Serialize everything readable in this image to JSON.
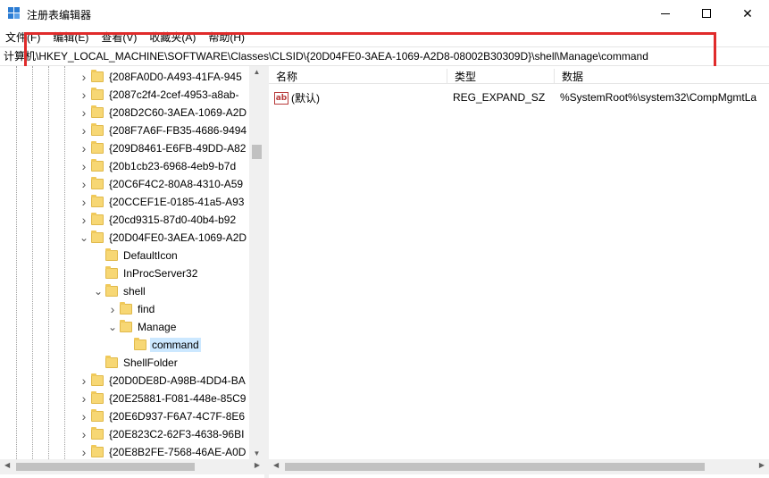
{
  "window": {
    "title": "注册表编辑器",
    "minimize_icon": "minimize-icon",
    "maximize_icon": "maximize-icon",
    "close_glyph": "✕"
  },
  "menu": [
    "文件(F)",
    "编辑(E)",
    "查看(V)",
    "收藏夹(A)",
    "帮助(H)"
  ],
  "address": "计算机\\HKEY_LOCAL_MACHINE\\SOFTWARE\\Classes\\CLSID\\{20D04FE0-3AEA-1069-A2D8-08002B30309D}\\shell\\Manage\\command",
  "tree": [
    {
      "label": "{208FA0D0-A493-41FA-945",
      "level": 0,
      "expander": ">"
    },
    {
      "label": "{2087c2f4-2cef-4953-a8ab-",
      "level": 0,
      "expander": ">"
    },
    {
      "label": "{208D2C60-3AEA-1069-A2D",
      "level": 0,
      "expander": ">"
    },
    {
      "label": "{208F7A6F-FB35-4686-9494",
      "level": 0,
      "expander": ">"
    },
    {
      "label": "{209D8461-E6FB-49DD-A82",
      "level": 0,
      "expander": ">"
    },
    {
      "label": "{20b1cb23-6968-4eb9-b7d",
      "level": 0,
      "expander": ">"
    },
    {
      "label": "{20C6F4C2-80A8-4310-A59",
      "level": 0,
      "expander": ">"
    },
    {
      "label": "{20CCEF1E-0185-41a5-A93",
      "level": 0,
      "expander": ">"
    },
    {
      "label": "{20cd9315-87d0-40b4-b92",
      "level": 0,
      "expander": ">"
    },
    {
      "label": "{20D04FE0-3AEA-1069-A2D",
      "level": 0,
      "expander": "v"
    },
    {
      "label": "DefaultIcon",
      "level": 1,
      "expander": ""
    },
    {
      "label": "InProcServer32",
      "level": 1,
      "expander": ""
    },
    {
      "label": "shell",
      "level": 1,
      "expander": "v"
    },
    {
      "label": "find",
      "level": 2,
      "expander": ">"
    },
    {
      "label": "Manage",
      "level": 2,
      "expander": "v"
    },
    {
      "label": "command",
      "level": 3,
      "expander": "",
      "selected": true
    },
    {
      "label": "ShellFolder",
      "level": 1,
      "expander": ""
    },
    {
      "label": "{20D0DE8D-A98B-4DD4-BA",
      "level": 0,
      "expander": ">"
    },
    {
      "label": "{20E25881-F081-448e-85C9",
      "level": 0,
      "expander": ">"
    },
    {
      "label": "{20E6D937-F6A7-4C7F-8E6",
      "level": 0,
      "expander": ">"
    },
    {
      "label": "{20E823C2-62F3-4638-96BI",
      "level": 0,
      "expander": ">"
    },
    {
      "label": "{20E8B2FE-7568-46AE-A0D",
      "level": 0,
      "expander": ">"
    }
  ],
  "columns": {
    "name": "名称",
    "type": "类型",
    "data": "数据"
  },
  "values": [
    {
      "icon": "ab",
      "name": "(默认)",
      "type": "REG_EXPAND_SZ",
      "data": "%SystemRoot%\\system32\\CompMgmtLa"
    }
  ],
  "colors": {
    "highlight_box": "#e02b2b",
    "selection": "#cce8ff",
    "folder": "#f7d774"
  }
}
